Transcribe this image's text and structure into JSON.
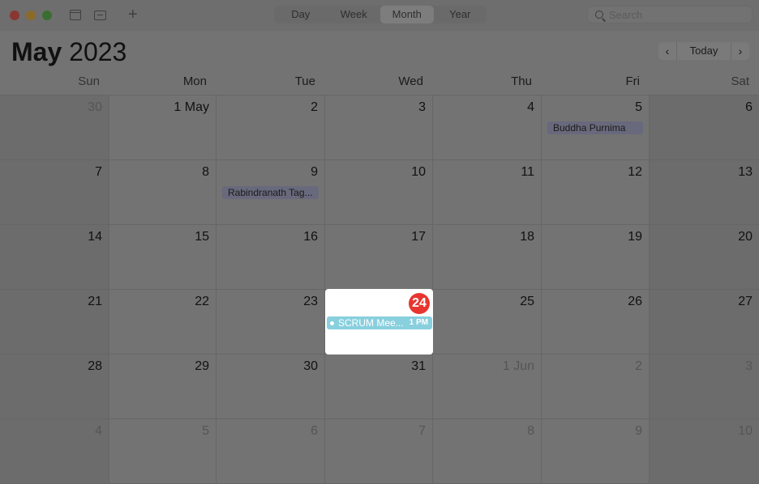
{
  "toolbar": {
    "views": [
      "Day",
      "Week",
      "Month",
      "Year"
    ],
    "active_view": "Month",
    "search_placeholder": "Search"
  },
  "header": {
    "month": "May",
    "year": "2023",
    "prev_icon": "chevron-left-icon",
    "today_label": "Today",
    "next_icon": "chevron-right-icon"
  },
  "weekdays": [
    "Sun",
    "Mon",
    "Tue",
    "Wed",
    "Thu",
    "Fri",
    "Sat"
  ],
  "weeks": [
    [
      {
        "label": "30",
        "dim": true
      },
      {
        "label": "1 May",
        "dim": false
      },
      {
        "label": "2",
        "dim": false
      },
      {
        "label": "3",
        "dim": false
      },
      {
        "label": "4",
        "dim": false
      },
      {
        "label": "5",
        "dim": false,
        "events": [
          "Buddha Purnima"
        ]
      },
      {
        "label": "6",
        "dim": false
      }
    ],
    [
      {
        "label": "7",
        "dim": false
      },
      {
        "label": "8",
        "dim": false
      },
      {
        "label": "9",
        "dim": false,
        "events": [
          "Rabindranath Tag..."
        ]
      },
      {
        "label": "10",
        "dim": false
      },
      {
        "label": "11",
        "dim": false
      },
      {
        "label": "12",
        "dim": false
      },
      {
        "label": "13",
        "dim": false
      }
    ],
    [
      {
        "label": "14",
        "dim": false
      },
      {
        "label": "15",
        "dim": false
      },
      {
        "label": "16",
        "dim": false
      },
      {
        "label": "17",
        "dim": false
      },
      {
        "label": "18",
        "dim": false
      },
      {
        "label": "19",
        "dim": false
      },
      {
        "label": "20",
        "dim": false
      }
    ],
    [
      {
        "label": "21",
        "dim": false
      },
      {
        "label": "22",
        "dim": false
      },
      {
        "label": "23",
        "dim": false
      },
      {
        "label": "24",
        "dim": false,
        "today": true
      },
      {
        "label": "25",
        "dim": false
      },
      {
        "label": "26",
        "dim": false
      },
      {
        "label": "27",
        "dim": false
      }
    ],
    [
      {
        "label": "28",
        "dim": false
      },
      {
        "label": "29",
        "dim": false
      },
      {
        "label": "30",
        "dim": false
      },
      {
        "label": "31",
        "dim": false
      },
      {
        "label": "1 Jun",
        "dim": true
      },
      {
        "label": "2",
        "dim": true
      },
      {
        "label": "3",
        "dim": true
      }
    ],
    [
      {
        "label": "4",
        "dim": true
      },
      {
        "label": "5",
        "dim": true
      },
      {
        "label": "6",
        "dim": true
      },
      {
        "label": "7",
        "dim": true
      },
      {
        "label": "8",
        "dim": true
      },
      {
        "label": "9",
        "dim": true
      },
      {
        "label": "10",
        "dim": true
      }
    ]
  ],
  "today_cell": {
    "day": "24",
    "event_title": "SCRUM Mee...",
    "event_time": "1 PM"
  },
  "colors": {
    "today_badge": "#e8352f",
    "event_scrum": "#89d0de",
    "holiday_event": "#68697c"
  }
}
